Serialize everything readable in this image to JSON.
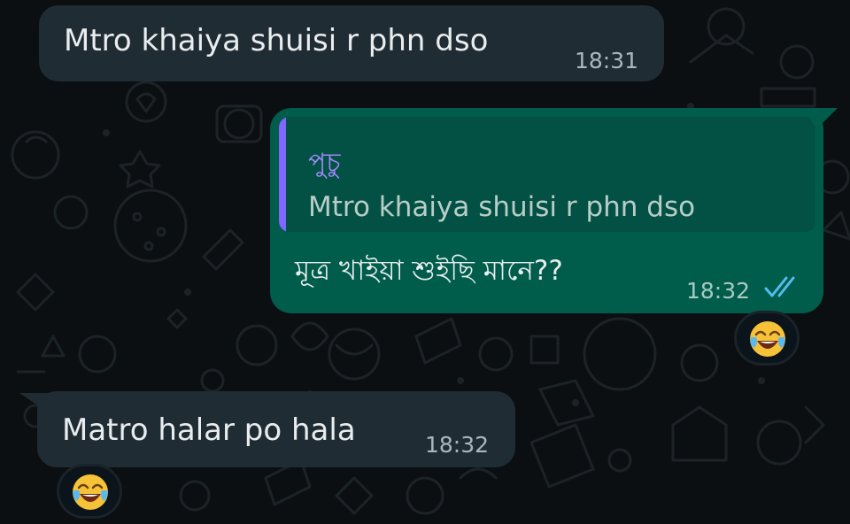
{
  "theme": {
    "background": "#0b0f11",
    "incoming_bubble": "#202c33",
    "outgoing_bubble": "#005c4b",
    "quote_accent": "#7f66ff",
    "read_tick_color": "#53bdeb"
  },
  "messages": [
    {
      "direction": "incoming",
      "text": "Mtro khaiya shuisi r phn dso",
      "time": "18:31"
    },
    {
      "direction": "outgoing",
      "quote": {
        "author": "পুচু",
        "text": "Mtro khaiya shuisi r phn dso"
      },
      "text": "মূত্র খাইয়া শুইছি মানে??",
      "time": "18:32",
      "status": "read",
      "status_icon": "double-check-icon",
      "reaction": "laughing-tears-emoji"
    },
    {
      "direction": "incoming",
      "text": "Matro halar po hala",
      "time": "18:32",
      "reaction": "laughing-tears-emoji"
    }
  ]
}
